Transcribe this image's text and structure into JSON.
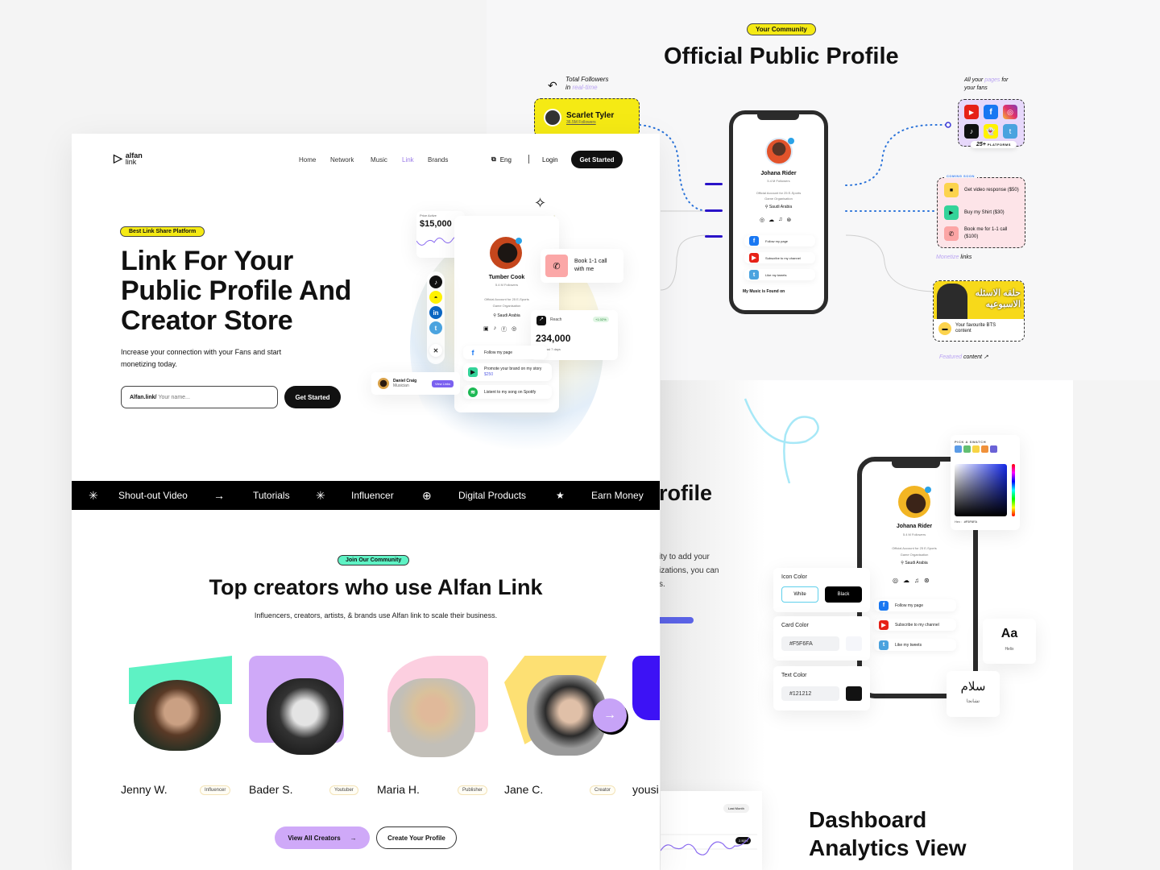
{
  "landing": {
    "logo": {
      "line1": "alfan",
      "line2": "link"
    },
    "nav": [
      {
        "label": "Home",
        "active": false
      },
      {
        "label": "Network",
        "active": false
      },
      {
        "label": "Music",
        "active": false
      },
      {
        "label": "Link",
        "active": true
      },
      {
        "label": "Brands",
        "active": false
      }
    ],
    "language": "Eng",
    "login": "Login",
    "get_started": "Get Started",
    "accent_color": "#9b7be8",
    "hero": {
      "badge": "Best Link Share Platform",
      "title_lines": [
        "Link For Your",
        "Public Profile And",
        "Creator Store"
      ],
      "subtitle_lines": [
        "Increase your connection with your Fans and start",
        "monetizing today."
      ],
      "input_prefix": "Alfan.link/",
      "input_placeholder": "Your name...",
      "cta": "Get Started"
    },
    "mockup": {
      "price_label": "Price Active",
      "price_value": "$15,000",
      "profile_name": "Tumber Cook",
      "profile_followers": "5.4 M Followers",
      "profile_desc_lines": [
        "Official Account for 25 E-Sports",
        "Game Organisation"
      ],
      "profile_location": "Saudi Arabia",
      "book_call": [
        "Book 1-1  call",
        "with me"
      ],
      "reach_label": "Reach",
      "reach_change": "+1.02%",
      "reach_value": "234,000",
      "reach_period": "From Last 7 days",
      "links": [
        {
          "icon": "facebook-icon",
          "label": "Follow my page"
        },
        {
          "icon": "megaphone-icon",
          "label": "Promote your brand on my story",
          "price": "$250"
        },
        {
          "icon": "spotify-icon",
          "label": "Listent to my song on Spotify"
        }
      ],
      "mini_profile": {
        "name": "Daniel Craig",
        "role": "Musician",
        "button": "View Links"
      }
    },
    "marquee": [
      {
        "icon": "asterisk-icon",
        "glyph": "✳",
        "label": "Shout-out Video"
      },
      {
        "icon": "arrow-right-icon",
        "glyph": "→",
        "label": "Tutorials"
      },
      {
        "icon": "asterisk-icon",
        "glyph": "✳",
        "label": "Influencer"
      },
      {
        "icon": "globe-icon",
        "glyph": "⊕",
        "label": "Digital Products"
      },
      {
        "icon": "star-icon",
        "glyph": "★",
        "label": "Earn Money"
      }
    ],
    "community": {
      "badge": "Join Our Community",
      "title": "Top creators who use Alfan Link",
      "subtitle": "Influencers, creators, artists, & brands use Alfan link to scale their business.",
      "creators": [
        {
          "name": "Jenny W.",
          "tag": "Influencer",
          "color": "#5ef2c4"
        },
        {
          "name": "Bader S.",
          "tag": "Youtuber",
          "color": "#cfa9f8"
        },
        {
          "name": "Maria H.",
          "tag": "Publisher",
          "color": "#fccfe0"
        },
        {
          "name": "Jane C.",
          "tag": "Creator",
          "color": "#fde073"
        },
        {
          "name": "yousi",
          "tag": "",
          "color": "#3d12f5"
        }
      ],
      "view_all": "View All Creators",
      "create_profile": "Create Your Profile"
    }
  },
  "public_profile": {
    "badge": "Your Community",
    "title": "Official Public Profile",
    "followers_note": {
      "line1": "Total Followers",
      "line2_prefix": "in ",
      "line2_highlight": "real-time"
    },
    "follower_card": {
      "name": "Scarlet Tyler",
      "followers": "36.5M Followers"
    },
    "phone": {
      "name": "Johana Rider",
      "followers": "5.4 M Followers",
      "desc_lines": [
        "Official Account for 25 E-Sports",
        "Game Organisation"
      ],
      "location": "Saudi Arabia",
      "links": [
        {
          "icon": "facebook-icon",
          "label": "Follow my page",
          "color": "#1877f2"
        },
        {
          "icon": "youtube-icon",
          "label": "Subscribe to my channel",
          "color": "#e62117"
        },
        {
          "icon": "twitter-icon",
          "label": "Like my tweets",
          "color": "#4aa3df"
        }
      ],
      "music_heading": "My Music is Found on"
    },
    "pages_note": {
      "prefix": "All your ",
      "highlight": "pages",
      "suffix": " for",
      "line2": "your fans"
    },
    "platforms": {
      "count": "25+",
      "label": "PLATFORMS"
    },
    "coming_soon": "COMING SOON",
    "monetize_items": [
      {
        "icon": "video-icon",
        "label": "Get video response ($50)",
        "color": "#fcd34d"
      },
      {
        "icon": "shirt-icon",
        "label": "Buy my Shirt ($30)",
        "color": "#34d399"
      },
      {
        "icon": "phone-icon",
        "label": "Book me for 1-1 call ($100)",
        "color": "#fca5a5"
      }
    ],
    "monetize_note": {
      "highlight": "Monetize",
      "suffix": " links"
    },
    "featured": {
      "banner_text": "حلقه الاسئله الاسبوعيه",
      "caption": "Your favourite BTS content"
    },
    "featured_note": {
      "highlight": "Featured",
      "suffix": " content"
    }
  },
  "customize": {
    "partial_title": "rofile",
    "partial_text_lines": [
      "ity to add your",
      "izations, you can",
      "s."
    ],
    "swatch_label": "PICK A SWATCH",
    "swatches": [
      "#5b9be6",
      "#62bf72",
      "#f7d445",
      "#f0913a",
      "#6a62d6"
    ],
    "hex_label": "Hex :",
    "hex_value": "#F5F6FA",
    "phone": {
      "name": "Johana Rider",
      "followers": "5.4 M Followers",
      "desc_lines": [
        "Official Account for 25 E-Sports",
        "Game Organisation"
      ],
      "location": "Saudi Arabia",
      "links": [
        "Follow my page",
        "Subscribe to my channel",
        "Like my tweets"
      ]
    },
    "icon_color": {
      "label": "Icon Color",
      "options": [
        "White",
        "Black"
      ],
      "selected": "White"
    },
    "card_color": {
      "label": "Card  Color",
      "value": "#F5F6FA"
    },
    "text_color": {
      "label": "Text Color",
      "value": "#121212"
    },
    "font_sample": {
      "glyph": "Aa",
      "name": "Helix"
    },
    "arabic_sample": {
      "glyph": "سلام",
      "name": "تشانجا"
    }
  },
  "dashboard": {
    "period": "Last Month",
    "change": "2.50%",
    "title_lines": [
      "Dashboard",
      "Analytics View"
    ]
  }
}
